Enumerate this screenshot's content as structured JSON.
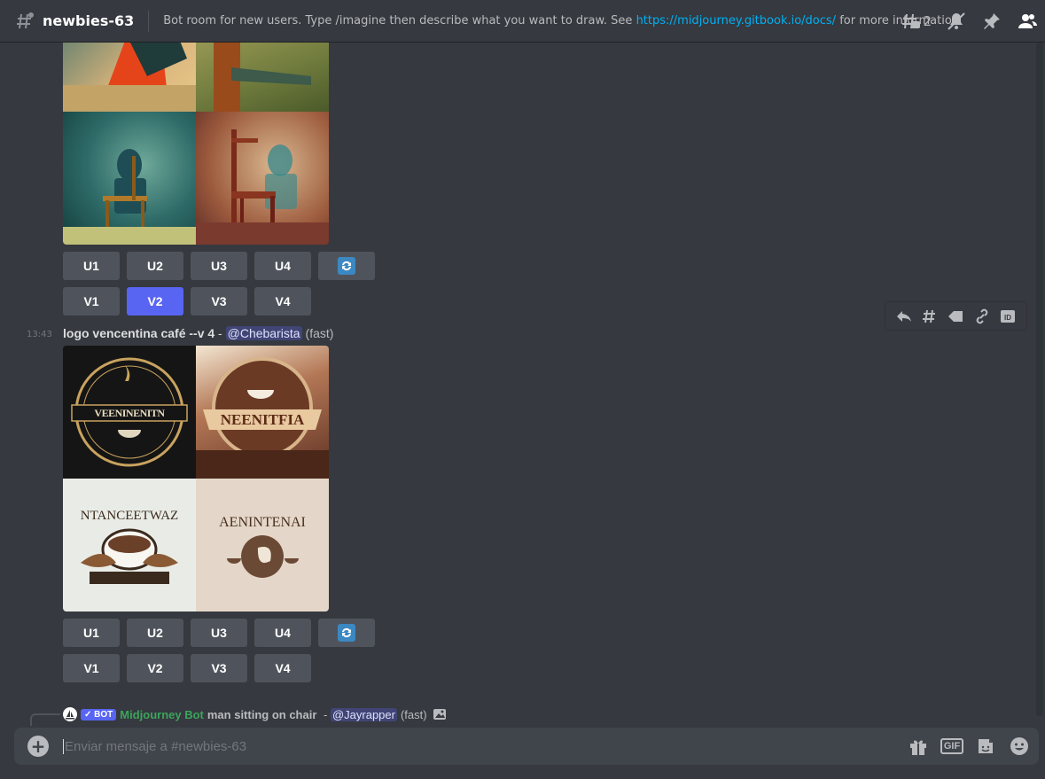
{
  "header": {
    "channel_name": "newbies-63",
    "topic_prefix": "Bot room for new users. Type /imagine then describe what you want to draw. See ",
    "topic_link": "https://midjourney.gitbook.io/docs/",
    "topic_suffix": " for more information",
    "threads_count": "2"
  },
  "messages": [
    {
      "id": "chair",
      "upscale_buttons": [
        "U1",
        "U2",
        "U3",
        "U4"
      ],
      "variation_buttons": [
        "V1",
        "V2",
        "V3",
        "V4"
      ],
      "active_button": "V2"
    },
    {
      "id": "logo",
      "timestamp": "13:43",
      "prompt": "logo vencentina café --v 4",
      "separator": " - ",
      "mention": "@Chebarista",
      "speed": "(fast)",
      "upscale_buttons": [
        "U1",
        "U2",
        "U3",
        "U4"
      ],
      "variation_buttons": [
        "V1",
        "V2",
        "V3",
        "V4"
      ],
      "logo_texts": [
        "VEENINENITN",
        "NEENITFIA",
        "NTANCEETWAZ",
        "AENINTENAI"
      ]
    }
  ],
  "reply": {
    "badge": "✓ BOT",
    "bot_name": "Midjourney Bot",
    "prompt": "man sitting on chair",
    "separator": " - ",
    "mention": "@Jayrapper",
    "speed": "(fast)"
  },
  "composer": {
    "placeholder": "Enviar mensaje a #newbies-63",
    "gif_label": "GIF"
  },
  "colors": {
    "blurple": "#5865f2",
    "bot_green": "#3ba55c",
    "link": "#00b0f4"
  }
}
